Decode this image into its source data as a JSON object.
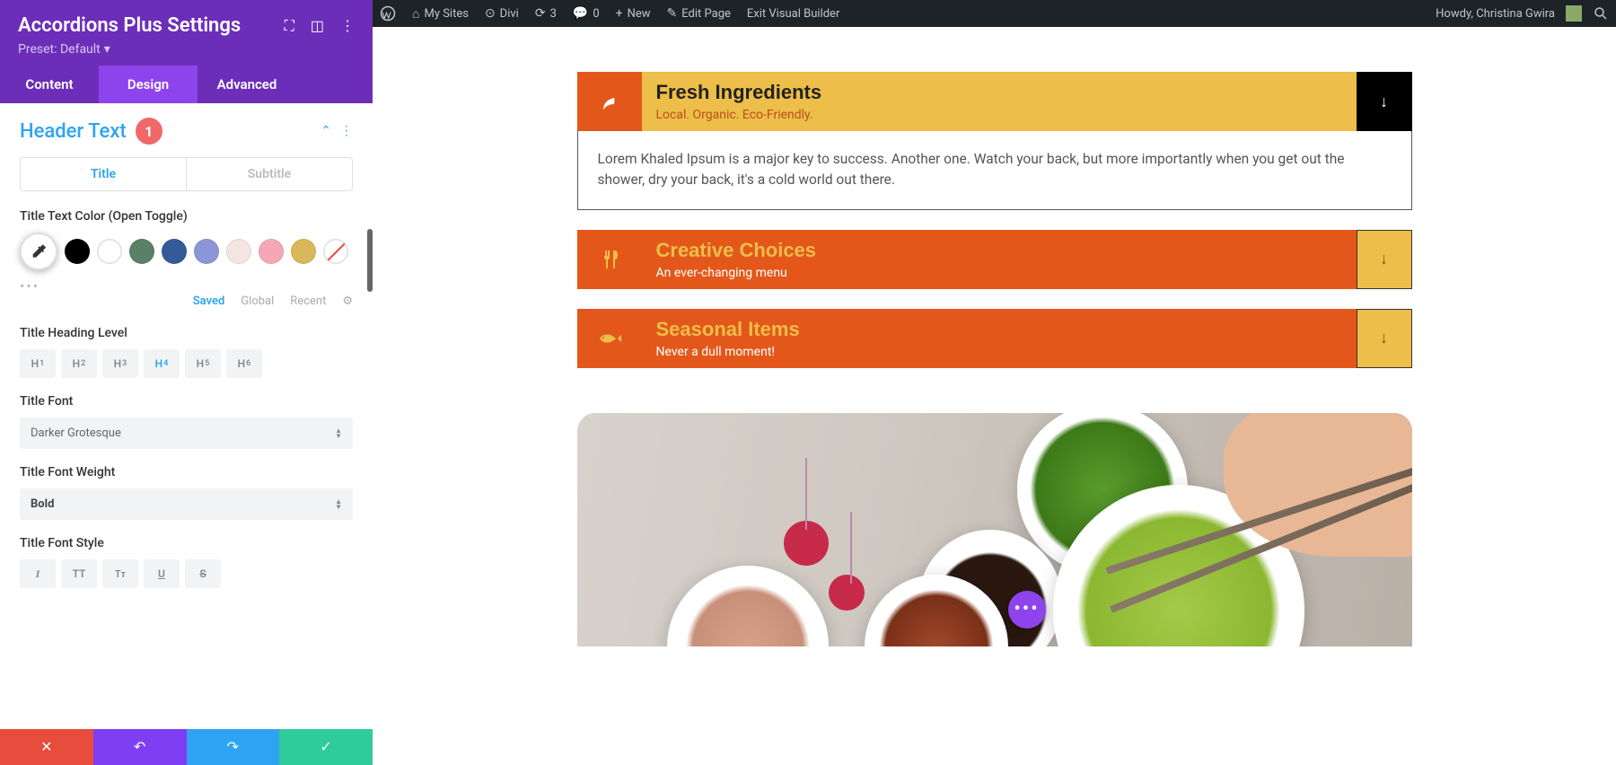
{
  "adminbar": {
    "mysites": "My Sites",
    "site": "Divi",
    "updates": "3",
    "comments": "0",
    "new": "New",
    "edit": "Edit Page",
    "exit": "Exit Visual Builder",
    "howdy": "Howdy, Christina Gwira"
  },
  "sidebar": {
    "title": "Accordions Plus Settings",
    "preset_label": "Preset: Default",
    "tabs": {
      "content": "Content",
      "design": "Design",
      "advanced": "Advanced"
    },
    "section": {
      "label": "Header Text",
      "badge": "1"
    },
    "subtabs": {
      "title": "Title",
      "subtitle": "Subtitle"
    },
    "fields": {
      "color_label": "Title Text Color (Open Toggle)",
      "heading_label": "Title Heading Level",
      "font_label": "Title Font",
      "font_value": "Darker Grotesque",
      "weight_label": "Title Font Weight",
      "weight_value": "Bold",
      "style_label": "Title Font Style"
    },
    "mini_tabs": {
      "saved": "Saved",
      "global": "Global",
      "recent": "Recent"
    },
    "heading_levels": [
      "1",
      "2",
      "3",
      "4",
      "5",
      "6"
    ],
    "swatches": [
      "#000000",
      "#ffffff",
      "#5a8068",
      "#335b9a",
      "#8a96d8",
      "#f5e5e2",
      "#f4a8b6",
      "#d9b85a"
    ]
  },
  "accordions": [
    {
      "title": "Fresh Ingredients",
      "subtitle": "Local. Organic. Eco-Friendly.",
      "icon": "leaf-icon",
      "body": "Lorem Khaled Ipsum is a major key to success. Another one. Watch your back, but more importantly when you get out the shower, dry your back, it's a cold world out there."
    },
    {
      "title": "Creative Choices",
      "subtitle": "An ever-changing menu",
      "icon": "utensils-icon"
    },
    {
      "title": "Seasonal Items",
      "subtitle": "Never a dull moment!",
      "icon": "fish-icon"
    }
  ]
}
